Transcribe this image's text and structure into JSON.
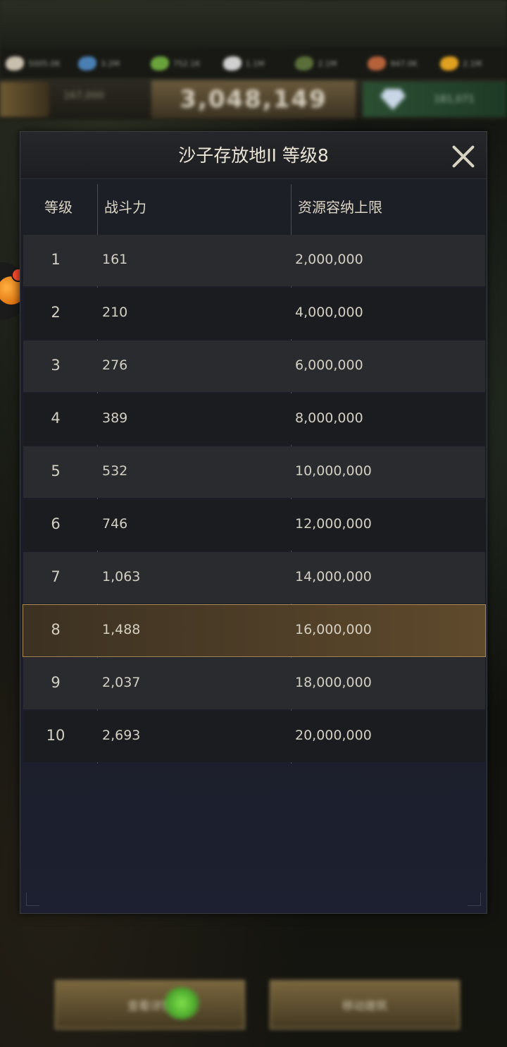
{
  "hud": {
    "resources": [
      {
        "icon": "meat-icon",
        "value": "5005.0K",
        "color": "#c9bfae"
      },
      {
        "icon": "water-icon",
        "value": "3.2M",
        "color": "#4a7fb3"
      },
      {
        "icon": "leaf-icon",
        "value": "752.1K",
        "color": "#6aa33c"
      },
      {
        "icon": "stone-icon",
        "value": "1.1M",
        "color": "#d0d0d0"
      },
      {
        "icon": "sand-icon",
        "value": "2.1M",
        "color": "#5a6e3a"
      },
      {
        "icon": "ore-icon",
        "value": "947.0K",
        "color": "#b5623a"
      },
      {
        "icon": "gold-icon",
        "value": "2.1M",
        "color": "#e0a020"
      }
    ],
    "stat_small": "167,000",
    "power": "3,048,149",
    "gems": "181,071"
  },
  "modal": {
    "title": "沙子存放地II  等级8",
    "columns": {
      "level": "等级",
      "power": "战斗力",
      "capacity": "资源容纳上限"
    },
    "rows": [
      {
        "level": "1",
        "power": "161",
        "capacity": "2,000,000"
      },
      {
        "level": "2",
        "power": "210",
        "capacity": "4,000,000"
      },
      {
        "level": "3",
        "power": "276",
        "capacity": "6,000,000"
      },
      {
        "level": "4",
        "power": "389",
        "capacity": "8,000,000"
      },
      {
        "level": "5",
        "power": "532",
        "capacity": "10,000,000"
      },
      {
        "level": "6",
        "power": "746",
        "capacity": "12,000,000"
      },
      {
        "level": "7",
        "power": "1,063",
        "capacity": "14,000,000"
      },
      {
        "level": "8",
        "power": "1,488",
        "capacity": "16,000,000"
      },
      {
        "level": "9",
        "power": "2,037",
        "capacity": "18,000,000"
      },
      {
        "level": "10",
        "power": "2,693",
        "capacity": "20,000,000"
      }
    ],
    "current_level": "8"
  },
  "footer": {
    "left_button": "查看详情",
    "right_button": "移动建筑"
  },
  "colors": {
    "highlight": "#5f4a2c",
    "title_text": "#e9e4d6",
    "row_dark": "#1b1c1f",
    "row_light": "#2a2b2f"
  }
}
